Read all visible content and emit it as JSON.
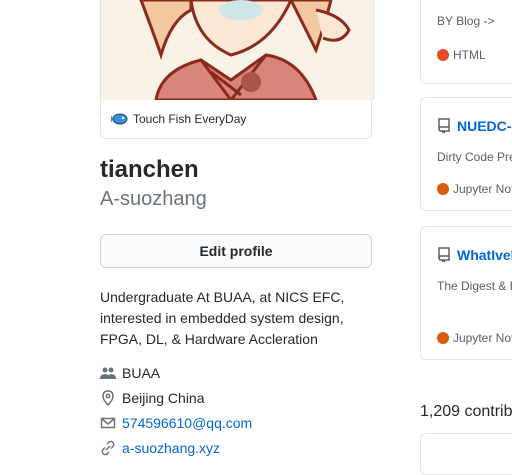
{
  "profile": {
    "status_text": "Touch Fish EveryDay",
    "fullname": "tianchen",
    "username": "A-suozhang",
    "edit_button": "Edit profile",
    "bio": "Undergraduate At BUAA, at NICS EFC, interested in embedded system design, FPGA, DL, & Hardware Accleration",
    "details": {
      "organization": "BUAA",
      "location": "Beijing China",
      "email": "574596610@qq.com",
      "website": "a-suozhang.xyz"
    }
  },
  "repos": [
    {
      "title": "",
      "description": "BY Blog ->",
      "language": "HTML",
      "lang_color": "#e34c26"
    },
    {
      "title": "NUEDC-C",
      "description": "Dirty Code Pre",
      "language": "Jupyter Not",
      "lang_color": "#da5b0b"
    },
    {
      "title": "WhatIvel",
      "description": "The Digest & F",
      "language": "Jupyter Not",
      "lang_color": "#da5b0b"
    }
  ],
  "contributions": "1,209 contrib"
}
